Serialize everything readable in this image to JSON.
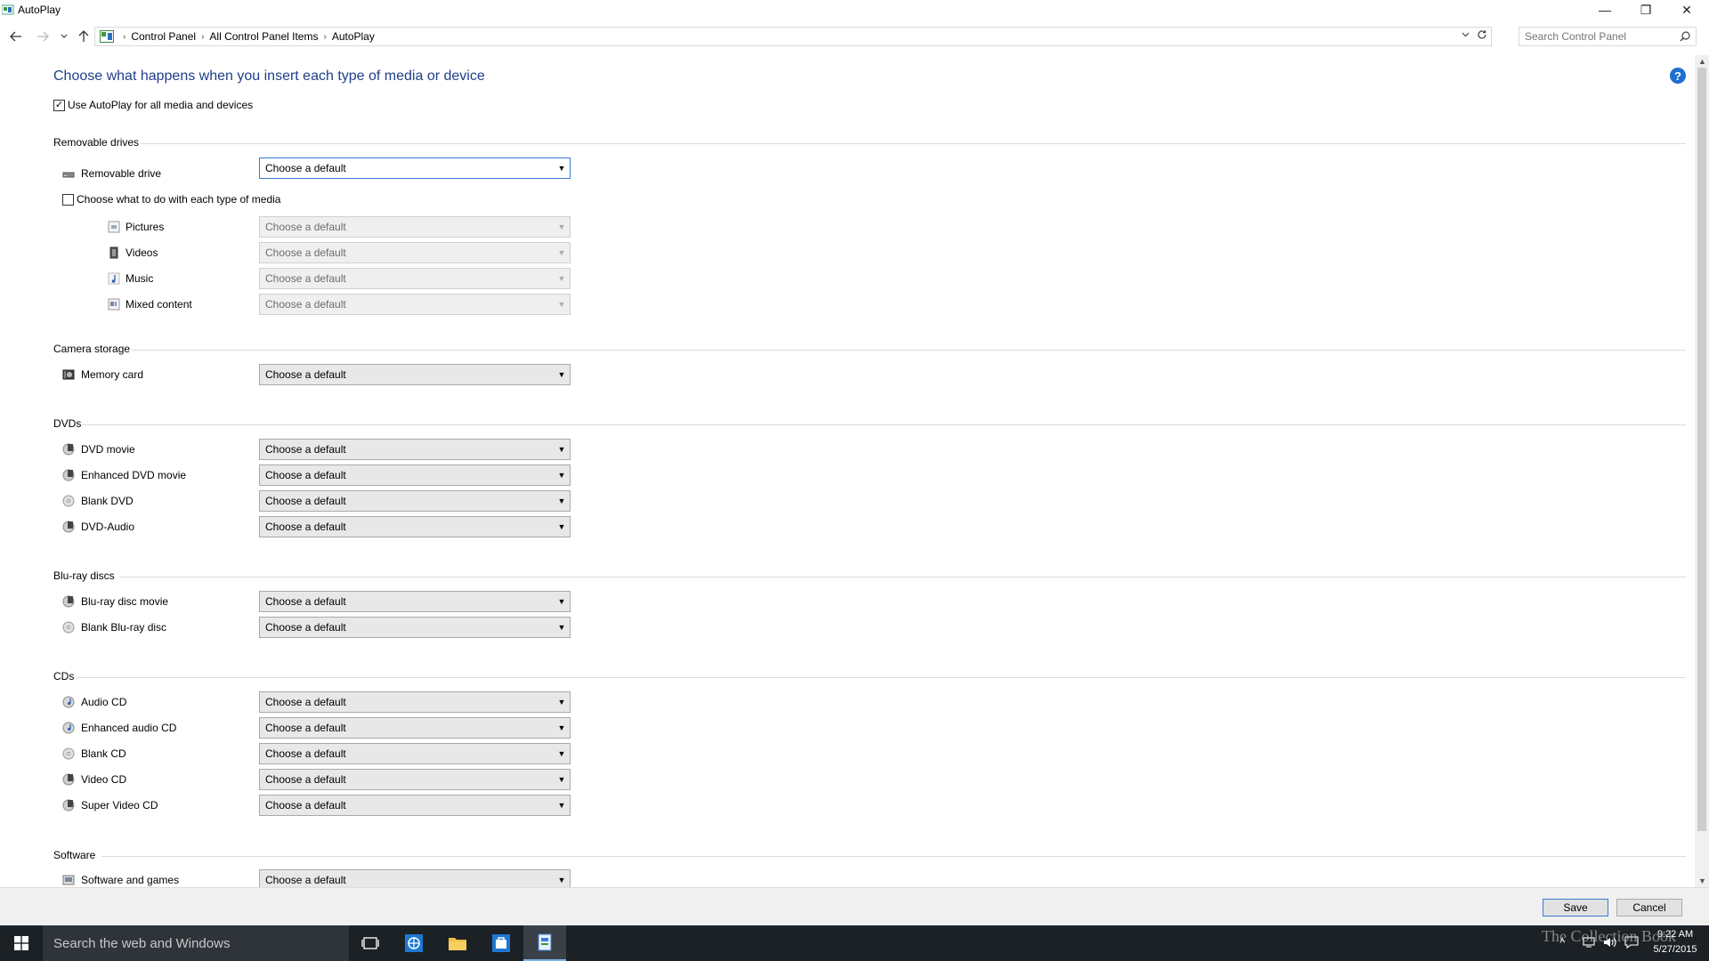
{
  "window": {
    "title": "AutoPlay",
    "minimize": "—",
    "restore": "❐",
    "close": "✕"
  },
  "address": {
    "crumbs": [
      "Control Panel",
      "All Control Panel Items",
      "AutoPlay"
    ],
    "search_placeholder": "Search Control Panel"
  },
  "main": {
    "title": "Choose what happens when you insert each type of media or device",
    "use_autoplay_label": "Use AutoPlay for all media and devices",
    "use_autoplay_checked": true,
    "choose_each_media_label": "Choose what to do with each type of media",
    "choose_each_media_checked": false,
    "default_option": "Choose a default"
  },
  "sections": {
    "removable": {
      "heading": "Removable drives",
      "removable_drive": "Removable drive",
      "pictures": "Pictures",
      "videos": "Videos",
      "music": "Music",
      "mixed": "Mixed content"
    },
    "camera": {
      "heading": "Camera storage",
      "memory_card": "Memory card"
    },
    "dvds": {
      "heading": "DVDs",
      "dvd_movie": "DVD movie",
      "enhanced_dvd_movie": "Enhanced DVD movie",
      "blank_dvd": "Blank DVD",
      "dvd_audio": "DVD-Audio"
    },
    "bluray": {
      "heading": "Blu-ray discs",
      "bluray_movie": "Blu-ray disc movie",
      "blank_bluray": "Blank Blu-ray disc"
    },
    "cds": {
      "heading": "CDs",
      "audio_cd": "Audio CD",
      "enhanced_audio_cd": "Enhanced audio CD",
      "blank_cd": "Blank CD",
      "video_cd": "Video CD",
      "super_video_cd": "Super Video CD"
    },
    "software": {
      "heading": "Software",
      "software_games": "Software and games"
    }
  },
  "buttons": {
    "save": "Save",
    "cancel": "Cancel"
  },
  "taskbar": {
    "search_text": "Search the web and Windows",
    "time": "9:22 AM",
    "date": "5/27/2015"
  },
  "watermark": "The Collection Book",
  "colors": {
    "title_blue": "#1e3f8a",
    "help_blue": "#1e6fd0",
    "taskbar": "#1c2126",
    "focus_blue": "#3a7bd5"
  }
}
